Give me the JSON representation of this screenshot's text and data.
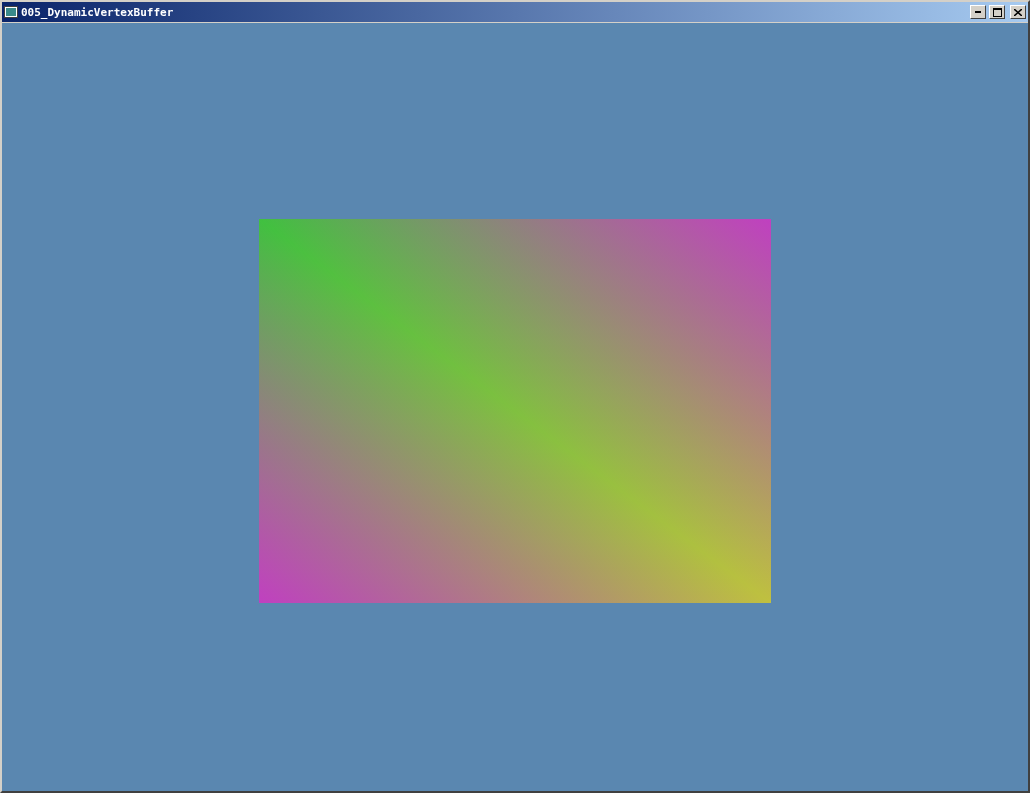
{
  "window": {
    "title": "005_DynamicVertexBuffer"
  }
}
